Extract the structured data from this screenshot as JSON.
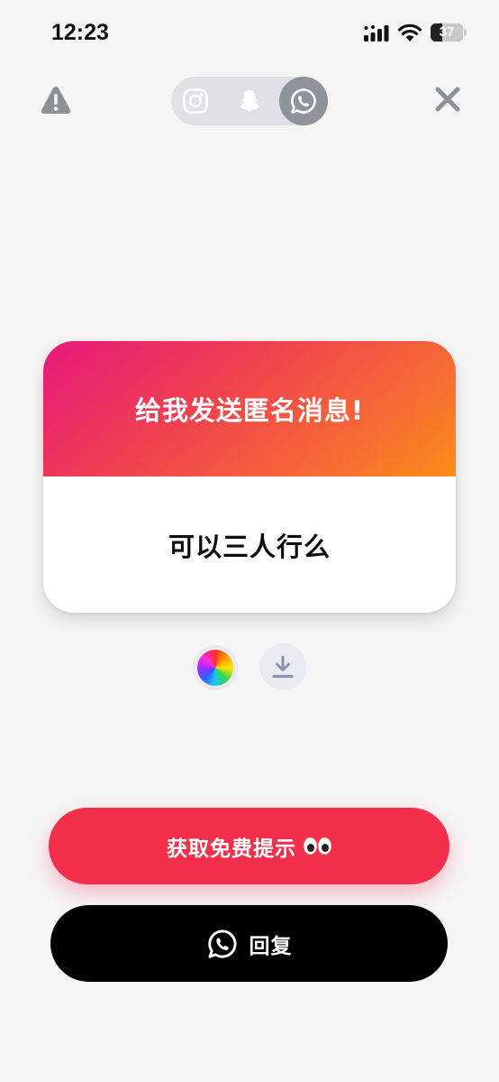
{
  "status_bar": {
    "time": "12:23",
    "battery": "37",
    "battery_level": 0.37
  },
  "top_bar": {
    "platforms": [
      "instagram",
      "snapchat",
      "whatsapp"
    ],
    "active_platform": "whatsapp"
  },
  "card": {
    "prompt": "给我发送匿名消息!",
    "message": "可以三人行么",
    "gradient_colors": [
      "#e7197d",
      "#f0414f",
      "#f66a35",
      "#fb8d16"
    ]
  },
  "tools": {
    "color_icon": "color-wheel-icon",
    "download_icon": "download-icon"
  },
  "actions": {
    "hint_label": "获取免费提示",
    "hint_emoji": "eyes-emoji",
    "hint_color": "#f2304c",
    "reply_label": "回复",
    "reply_icon": "whatsapp-icon"
  }
}
